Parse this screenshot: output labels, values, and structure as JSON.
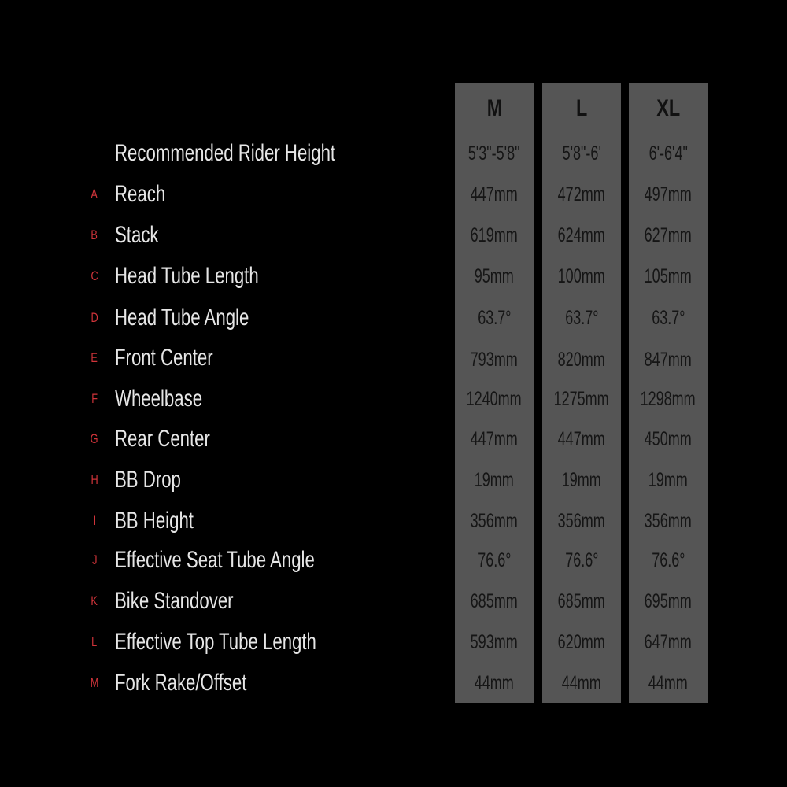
{
  "sizes": [
    "M",
    "L",
    "XL"
  ],
  "colors": {
    "background": "#000000",
    "column": "#555555",
    "label_text": "#e6e6e6",
    "letter_accent": "#d0343a",
    "value_text": "#151515"
  },
  "rows": [
    {
      "letter": "",
      "label": "Recommended Rider Height",
      "values": [
        "5'3\"-5'8\"",
        "5'8\"-6'",
        "6'-6'4\""
      ]
    },
    {
      "letter": "A",
      "label": "Reach",
      "values": [
        "447mm",
        "472mm",
        "497mm"
      ]
    },
    {
      "letter": "B",
      "label": "Stack",
      "values": [
        "619mm",
        "624mm",
        "627mm"
      ]
    },
    {
      "letter": "C",
      "label": "Head Tube Length",
      "values": [
        "95mm",
        "100mm",
        "105mm"
      ]
    },
    {
      "letter": "D",
      "label": "Head Tube Angle",
      "values": [
        "63.7°",
        "63.7°",
        "63.7°"
      ]
    },
    {
      "letter": "E",
      "label": "Front Center",
      "values": [
        "793mm",
        "820mm",
        "847mm"
      ]
    },
    {
      "letter": "F",
      "label": "Wheelbase",
      "values": [
        "1240mm",
        "1275mm",
        "1298mm"
      ]
    },
    {
      "letter": "G",
      "label": "Rear Center",
      "values": [
        "447mm",
        "447mm",
        "450mm"
      ]
    },
    {
      "letter": "H",
      "label": "BB Drop",
      "values": [
        "19mm",
        "19mm",
        "19mm"
      ]
    },
    {
      "letter": "I",
      "label": "BB Height",
      "values": [
        "356mm",
        "356mm",
        "356mm"
      ]
    },
    {
      "letter": "J",
      "label": "Effective Seat Tube Angle",
      "values": [
        "76.6°",
        "76.6°",
        "76.6°"
      ]
    },
    {
      "letter": "K",
      "label": "Bike Standover",
      "values": [
        "685mm",
        "685mm",
        "695mm"
      ]
    },
    {
      "letter": "L",
      "label": "Effective Top Tube Length",
      "values": [
        "593mm",
        "620mm",
        "647mm"
      ]
    },
    {
      "letter": "M",
      "label": "Fork Rake/Offset",
      "values": [
        "44mm",
        "44mm",
        "44mm"
      ]
    }
  ]
}
